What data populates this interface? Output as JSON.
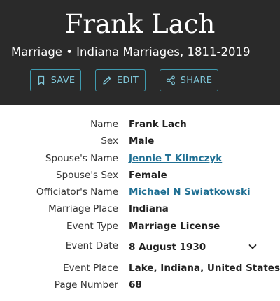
{
  "header": {
    "title": "Frank Lach",
    "subtitle": "Marriage • Indiana Marriages, 1811-2019"
  },
  "actions": {
    "save_label": "SAVE",
    "edit_label": "EDIT",
    "share_label": "SHARE"
  },
  "details": [
    {
      "label": "Name",
      "value": "Frank Lach"
    },
    {
      "label": "Sex",
      "value": "Male"
    },
    {
      "label": "Spouse's Name",
      "value": "Jennie T Klimczyk"
    },
    {
      "label": "Spouse's Sex",
      "value": "Female"
    },
    {
      "label": "Officiator's Name",
      "value": "Michael N Swiatkowski"
    },
    {
      "label": "Marriage Place",
      "value": "Indiana"
    },
    {
      "label": "Event Type",
      "value": "Marriage License"
    },
    {
      "label": "Event Date",
      "value": "8 August 1930"
    },
    {
      "label": "Event Place",
      "value": "Lake, Indiana, United States"
    },
    {
      "label": "Page Number",
      "value": "68"
    }
  ],
  "colors": {
    "header_bg": "#2a2a2a",
    "accent": "#3f9bb0",
    "link": "#1f6f93"
  },
  "icons": [
    "bookmark-icon",
    "pencil-icon",
    "share-icon",
    "chevron-down-icon"
  ]
}
